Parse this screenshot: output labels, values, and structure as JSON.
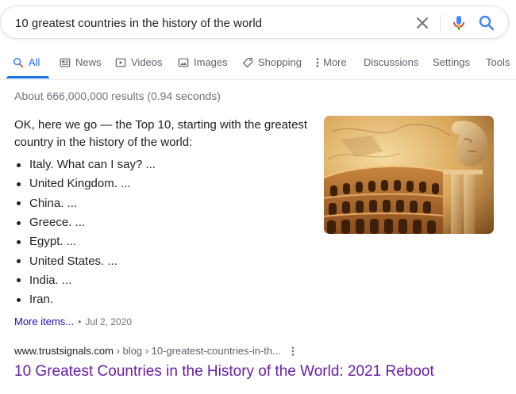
{
  "search": {
    "query": "10 greatest countries in the history of the world"
  },
  "tabs": [
    {
      "label": "All",
      "icon": "search-icon",
      "active": true
    },
    {
      "label": "News",
      "icon": "news-icon"
    },
    {
      "label": "Videos",
      "icon": "video-icon"
    },
    {
      "label": "Images",
      "icon": "image-icon"
    },
    {
      "label": "Shopping",
      "icon": "tag-icon"
    },
    {
      "label": "More",
      "icon": "more-vertical-icon"
    },
    {
      "label": "Discussions"
    },
    {
      "label": "Settings"
    },
    {
      "label": "Tools"
    }
  ],
  "result_stats": "About 666,000,000 results (0.94 seconds)",
  "featured_snippet": {
    "lead": "OK, here we go — the Top 10, starting with the greatest country in the history of the world:",
    "items": [
      "Italy. What can I say? ...",
      "United Kingdom. ...",
      "China. ...",
      "Greece. ...",
      "Egypt. ...",
      "United States. ...",
      "India. ...",
      "Iran."
    ],
    "more_label": "More items...",
    "separator": "•",
    "date": "Jul 2, 2020",
    "image_alt": "colosseum-collage-image"
  },
  "result": {
    "domain": "www.trustsignals.com",
    "path": " › blog › 10-greatest-countries-in-th...",
    "title": "10 Greatest Countries in the History of the World: 2021 Reboot"
  },
  "colors": {
    "accent_blue": "#1a73e8",
    "link_blue": "#1a0dab",
    "visited_purple": "#681da8",
    "meta_gray": "#70757a"
  }
}
